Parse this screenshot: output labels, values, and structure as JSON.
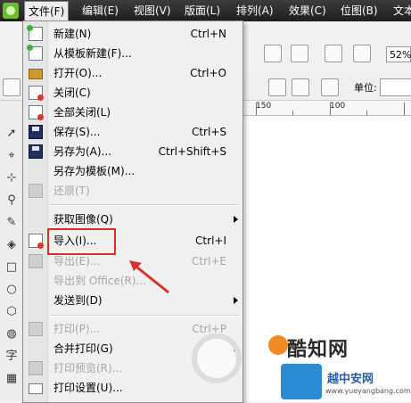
{
  "menubar": {
    "items": [
      {
        "label": "文件(F)",
        "active": true
      },
      {
        "label": "编辑(E)"
      },
      {
        "label": "视图(V)"
      },
      {
        "label": "版面(L)"
      },
      {
        "label": "排列(A)"
      },
      {
        "label": "效果(C)"
      },
      {
        "label": "位图(B)"
      },
      {
        "label": "文本"
      }
    ]
  },
  "toolbar": {
    "zoom_value": "52%",
    "unit_label": "单位:"
  },
  "ruler": {
    "labels": [
      "150",
      "100"
    ]
  },
  "file_menu": {
    "items": [
      {
        "label": "新建(N)",
        "shortcut": "Ctrl+N",
        "icon": "new-doc-icon"
      },
      {
        "label": "从模板新建(F)...",
        "shortcut": "",
        "icon": "new-from-template-icon"
      },
      {
        "label": "打开(O)...",
        "shortcut": "Ctrl+O",
        "icon": "folder-open-icon"
      },
      {
        "label": "关闭(C)",
        "shortcut": "",
        "icon": "close-doc-icon"
      },
      {
        "label": "全部关闭(L)",
        "shortcut": "",
        "icon": "close-all-icon"
      },
      {
        "label": "保存(S)...",
        "shortcut": "Ctrl+S",
        "icon": "save-icon"
      },
      {
        "label": "另存为(A)...",
        "shortcut": "Ctrl+Shift+S",
        "icon": "save-as-icon"
      },
      {
        "label": "另存为模板(M)...",
        "shortcut": "",
        "icon": ""
      },
      {
        "label": "还原(T)",
        "shortcut": "",
        "icon": "revert-icon",
        "disabled": true
      },
      {
        "label": "获取图像(Q)",
        "shortcut": "",
        "submenu": true
      },
      {
        "label": "导入(I)...",
        "shortcut": "Ctrl+I",
        "icon": "import-icon"
      },
      {
        "label": "导出(E)...",
        "shortcut": "Ctrl+E",
        "icon": "export-icon",
        "disabled": true
      },
      {
        "label": "导出到 Office(R)...",
        "shortcut": "",
        "disabled": true
      },
      {
        "label": "发送到(D)",
        "shortcut": "",
        "submenu": true
      },
      {
        "label": "打印(P)...",
        "shortcut": "Ctrl+P",
        "icon": "print-icon",
        "disabled": true
      },
      {
        "label": "合并打印(G)",
        "shortcut": "",
        "submenu": true
      },
      {
        "label": "打印预览(R)...",
        "shortcut": "",
        "icon": "print-preview-icon",
        "disabled": true
      },
      {
        "label": "打印设置(U)...",
        "shortcut": "",
        "icon": "print-setup-icon"
      }
    ]
  },
  "watermark": {
    "title": "酷知网",
    "subtitle": "越中安网",
    "url": "www.yueyangbang.com"
  },
  "colors": {
    "highlight": "#d9302c",
    "menubar": "#2b2b2b"
  }
}
